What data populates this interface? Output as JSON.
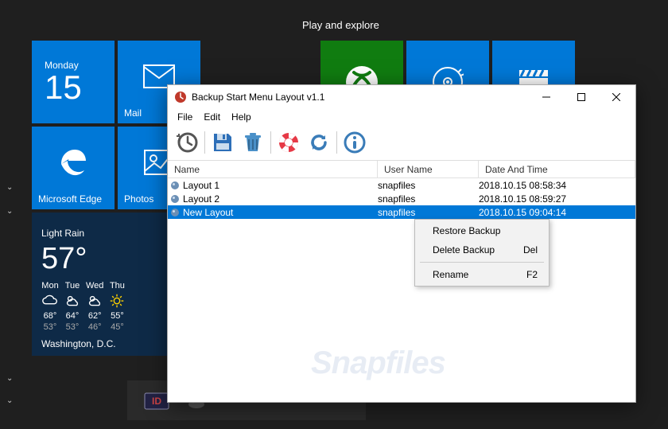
{
  "start_menu": {
    "category": "Play and explore",
    "calendar": {
      "weekday": "Monday",
      "date": "15"
    },
    "tiles": {
      "mail": "Mail",
      "edge": "Microsoft Edge",
      "photos": "Photos"
    },
    "weather": {
      "condition": "Light Rain",
      "temp": "57°",
      "city": "Washington, D.C.",
      "forecast": [
        {
          "day": "Mon",
          "hi": "68°",
          "lo": "53°"
        },
        {
          "day": "Tue",
          "hi": "64°",
          "lo": "53°"
        },
        {
          "day": "Wed",
          "hi": "62°",
          "lo": "46°"
        },
        {
          "day": "Thu",
          "hi": "55°",
          "lo": "45°"
        }
      ]
    }
  },
  "window": {
    "title": "Backup Start Menu Layout v1.1",
    "menu": {
      "file": "File",
      "edit": "Edit",
      "help": "Help"
    },
    "columns": {
      "name": "Name",
      "user": "User Name",
      "date": "Date And Time"
    },
    "rows": [
      {
        "name": "Layout 1",
        "user": "snapfiles",
        "date": "2018.10.15 08:58:34"
      },
      {
        "name": "Layout 2",
        "user": "snapfiles",
        "date": "2018.10.15 08:59:27"
      },
      {
        "name": "New Layout",
        "user": "snapfiles",
        "date": "2018.10.15 09:04:14"
      }
    ],
    "context_menu": {
      "restore": "Restore Backup",
      "delete": "Delete Backup",
      "delete_key": "Del",
      "rename": "Rename",
      "rename_key": "F2"
    }
  },
  "watermark": "Snapfiles"
}
